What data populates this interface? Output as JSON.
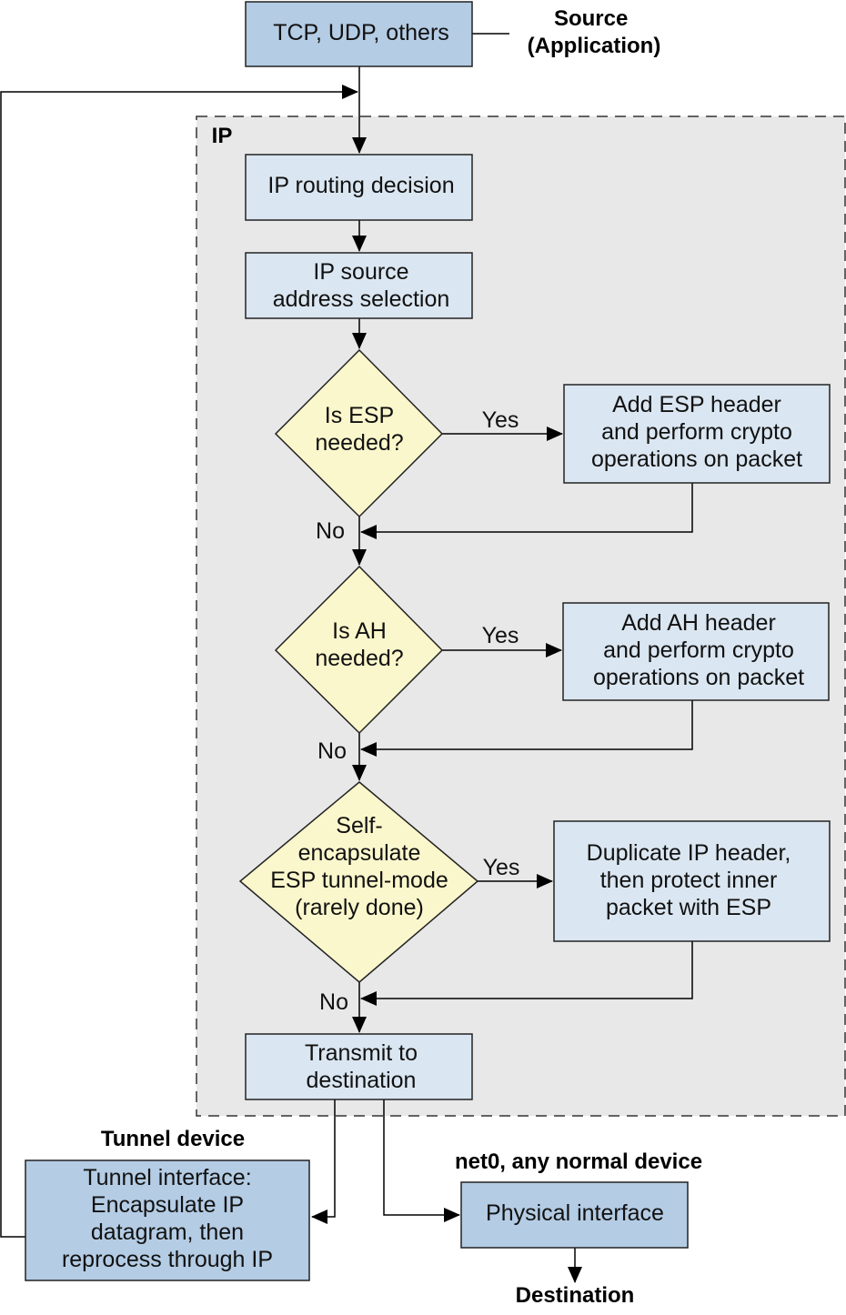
{
  "labels": {
    "source": [
      "Source",
      "(Application)"
    ],
    "ip": "IP",
    "tunnel_device": "Tunnel device",
    "net0": "net0, any normal device",
    "destination": "Destination"
  },
  "nodes": {
    "tcp": [
      "TCP, UDP, others"
    ],
    "routing": [
      "IP routing decision"
    ],
    "source_sel": [
      "IP source",
      "address selection"
    ],
    "esp_q": [
      "Is ESP",
      "needed?"
    ],
    "esp_add": [
      "Add ESP header",
      "and perform crypto",
      "operations on packet"
    ],
    "ah_q": [
      "Is AH",
      "needed?"
    ],
    "ah_add": [
      "Add AH header",
      "and perform crypto",
      "operations on packet"
    ],
    "self_q": [
      "Self-",
      "encapsulate",
      "ESP tunnel-mode",
      "(rarely done)"
    ],
    "dup": [
      "Duplicate IP header,",
      "then protect inner",
      "packet with ESP"
    ],
    "transmit": [
      "Transmit to",
      "destination"
    ],
    "tunnel": [
      "Tunnel interface:",
      "Encapsulate IP",
      "datagram, then",
      "reprocess through IP"
    ],
    "physical": [
      "Physical interface"
    ]
  },
  "edge_labels": {
    "yes": "Yes",
    "no": "No"
  },
  "colors": {
    "dark_box": "#b4cce4",
    "light_box": "#dae6f1",
    "decision": "#fbf7cc",
    "ip_region": "#e8e8e8"
  }
}
